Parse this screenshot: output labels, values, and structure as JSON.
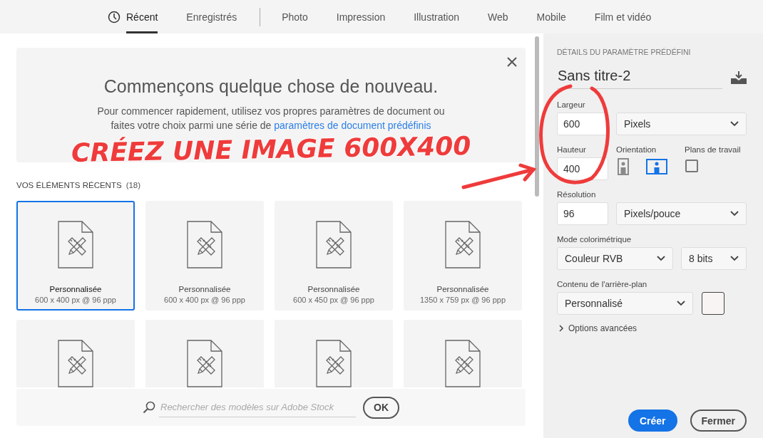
{
  "tab_groups": [
    [
      {
        "label": "Récent",
        "selected": true,
        "has_icon": true
      },
      {
        "label": "Enregistrés",
        "selected": false,
        "has_icon": false
      }
    ],
    [
      {
        "label": "Photo",
        "selected": false,
        "has_icon": false
      },
      {
        "label": "Impression",
        "selected": false,
        "has_icon": false
      },
      {
        "label": "Illustration",
        "selected": false,
        "has_icon": false
      },
      {
        "label": "Web",
        "selected": false,
        "has_icon": false
      },
      {
        "label": "Mobile",
        "selected": false,
        "has_icon": false
      },
      {
        "label": "Film et vidéo",
        "selected": false,
        "has_icon": false
      }
    ]
  ],
  "banner": {
    "title": "Commençons quelque chose de nouveau.",
    "text": "Pour commencer rapidement, utilisez vos propres paramètres de document ou faites votre choix parmi une série de ",
    "link": "paramètres de document prédéfinis"
  },
  "recent": {
    "heading": "VOS ÉLÉMENTS RÉCENTS",
    "count": "(18)",
    "items": [
      {
        "name": "Personnalisée",
        "size": "600 x 400 px @ 96 ppp",
        "selected": true
      },
      {
        "name": "Personnalisée",
        "size": "600 x 400 px @ 96 ppp",
        "selected": false
      },
      {
        "name": "Personnalisée",
        "size": "600 x 450 px @ 96 ppp",
        "selected": false
      },
      {
        "name": "Personnalisée",
        "size": "1350 x 759 px @ 96 ppp",
        "selected": false
      },
      {
        "selected": false
      },
      {
        "selected": false
      },
      {
        "selected": false
      },
      {
        "selected": false
      }
    ]
  },
  "search": {
    "placeholder": "Rechercher des modèles sur Adobe Stock",
    "button": "OK"
  },
  "details": {
    "heading": "DÉTAILS DU PARAMÈTRE PRÉDÉFINI",
    "preset_name": "Sans titre-2",
    "width": {
      "label": "Largeur",
      "value": "600",
      "unit": "Pixels"
    },
    "height": {
      "label": "Hauteur",
      "value": "400"
    },
    "orientation": {
      "label": "Orientation",
      "options": [
        {
          "kind": "portrait",
          "selected": false
        },
        {
          "kind": "landscape",
          "selected": true
        }
      ]
    },
    "artboards": {
      "label": "Plans de travail",
      "checked": false
    },
    "resolution": {
      "label": "Résolution",
      "value": "96",
      "unit": "Pixels/pouce"
    },
    "color_mode": {
      "label": "Mode colorimétrique",
      "mode": "Couleur RVB",
      "depth": "8 bits"
    },
    "background": {
      "label": "Contenu de l'arrière-plan",
      "value": "Personnalisé",
      "color": "#f8f4f4"
    },
    "advanced": {
      "label": "Options avancées",
      "expanded": false
    },
    "buttons": [
      {
        "label": "Créer",
        "kind": "primary"
      },
      {
        "label": "Fermer",
        "kind": "secondary"
      }
    ]
  },
  "annotation": {
    "text": "CRÉEZ UNE IMAGE 600X400"
  }
}
